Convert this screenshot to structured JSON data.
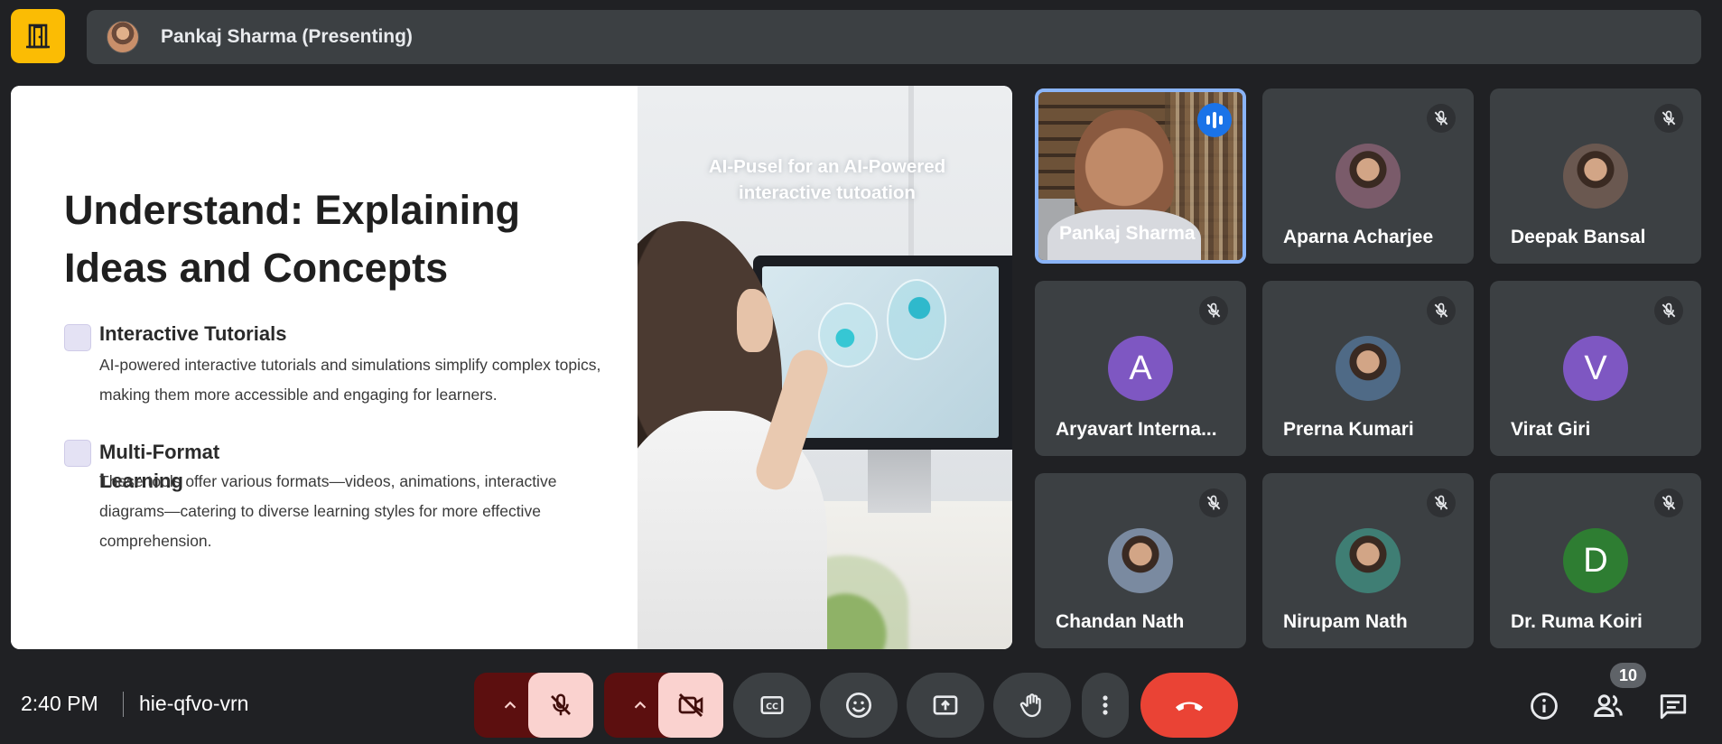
{
  "header": {
    "presenter_label": "Pankaj Sharma (Presenting)"
  },
  "slide": {
    "title": "Understand: Explaining Ideas and Concepts",
    "bullets": [
      {
        "heading": "Interactive Tutorials",
        "text": "AI-powered interactive tutorials and simulations simplify complex topics, making them more accessible and engaging for learners."
      },
      {
        "heading": "Multi-Format Learning",
        "text": "These tools offer various formats—videos, animations, interactive diagrams—catering to diverse learning styles for more effective comprehension."
      }
    ],
    "image_caption": "AI-Pusel for an AI-Powered interactive tutoation"
  },
  "participants": [
    {
      "name": "Pankaj Sharma",
      "state": "speaking",
      "avatar": "video"
    },
    {
      "name": "Aparna Acharjee",
      "state": "muted",
      "avatar": "photo",
      "color": "#7a5b6a"
    },
    {
      "name": "Deepak Bansal",
      "state": "muted",
      "avatar": "photo",
      "color": "#6a5850"
    },
    {
      "name": "Aryavart Interna...",
      "state": "muted",
      "avatar": "letter",
      "letter": "A",
      "color": "#7e57c2"
    },
    {
      "name": "Prerna Kumari",
      "state": "muted",
      "avatar": "photo",
      "color": "#4f6a86"
    },
    {
      "name": "Virat Giri",
      "state": "muted",
      "avatar": "letter",
      "letter": "V",
      "color": "#7e57c2"
    },
    {
      "name": "Chandan Nath",
      "state": "muted",
      "avatar": "photo",
      "color": "#7a8aa0"
    },
    {
      "name": "Nirupam Nath",
      "state": "muted",
      "avatar": "photo",
      "color": "#3f7e74"
    },
    {
      "name": "Dr. Ruma Koiri",
      "state": "muted",
      "avatar": "letter",
      "letter": "D",
      "color": "#2e7d32"
    }
  ],
  "footer": {
    "time": "2:40 PM",
    "meeting_code": "hie-qfvo-vrn",
    "participant_count": "10"
  },
  "colors": {
    "background": "#202124",
    "tile": "#3c4043",
    "accent_blue": "#8ab4f8",
    "end_call_red": "#ea4335",
    "exit_yellow": "#fbbc04"
  },
  "icons": [
    "exit-door-icon",
    "mic-off-icon",
    "camera-off-icon",
    "captions-icon",
    "emoji-icon",
    "present-icon",
    "raise-hand-icon",
    "more-options-icon",
    "end-call-icon",
    "info-icon",
    "people-icon",
    "chat-icon"
  ]
}
